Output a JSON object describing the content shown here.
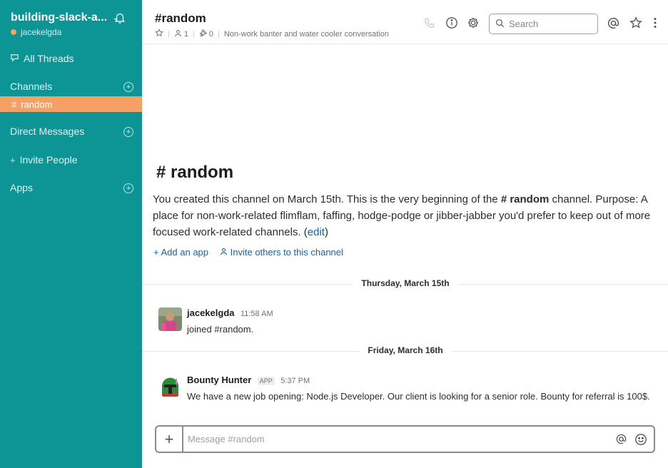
{
  "sidebar": {
    "team_name": "building-slack-a...",
    "team_caret": "⌄",
    "username": "jacekelgda",
    "all_threads": "All Threads",
    "channels_label": "Channels",
    "active_channel": "random",
    "direct_messages_label": "Direct Messages",
    "invite_people": "Invite People",
    "apps_label": "Apps"
  },
  "header": {
    "channel_title": "#random",
    "members_count": "1",
    "pinned_count": "0",
    "purpose": "Non-work banter and water cooler conversation",
    "search_placeholder": "Search"
  },
  "intro": {
    "title": "random",
    "created_prefix": "You created this channel on March 15th. This is the very beginning of the ",
    "channel_ref": "random",
    "created_suffix": " channel.",
    "purpose_prefix": "Purpose: A place for non-work-related flimflam, faffing, hodge-podge or jibber-jabber you'd prefer to keep out of more focused work-related channels. (",
    "edit_link": "edit",
    "purpose_suffix": ")",
    "add_app": "Add an app",
    "invite_others": "Invite others to this channel"
  },
  "days": [
    {
      "label": "Thursday, March 15th"
    },
    {
      "label": "Friday, March 16th"
    }
  ],
  "messages": [
    {
      "author": "jacekelgda",
      "time": "11:58 AM",
      "text": "joined #random."
    },
    {
      "author": "Bounty Hunter",
      "badge": "APP",
      "time": "5:37 PM",
      "text": "We have a new job opening: Node.js Developer. Our client is looking for a senior role. Bounty for referral is 100$."
    }
  ],
  "composer": {
    "placeholder": "Message #random"
  },
  "colors": {
    "sidebar_bg": "#0d9595",
    "active_channel_bg": "#f7a066",
    "link": "#1264a3"
  }
}
